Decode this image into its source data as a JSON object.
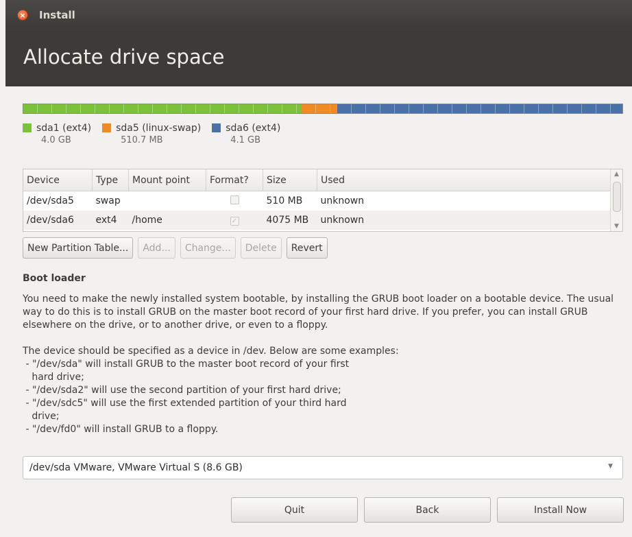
{
  "window": {
    "title": "Install"
  },
  "header": {
    "title": "Allocate drive space"
  },
  "partitions": [
    {
      "label": "sda1 (ext4)",
      "size": "4.0 GB",
      "color": "#7bc23a",
      "share": 0.465
    },
    {
      "label": "sda5 (linux-swap)",
      "size": "510.7 MB",
      "color": "#f08a25",
      "share": 0.059
    },
    {
      "label": "sda6 (ext4)",
      "size": "4.1 GB",
      "color": "#4a72a8",
      "share": 0.476
    }
  ],
  "table": {
    "columns": [
      "Device",
      "Type",
      "Mount point",
      "Format?",
      "Size",
      "Used"
    ],
    "rows": [
      {
        "device": "/dev/sda5",
        "type": "swap",
        "mount": "",
        "format": false,
        "size": "510 MB",
        "used": "unknown"
      },
      {
        "device": "/dev/sda6",
        "type": "ext4",
        "mount": "/home",
        "format": true,
        "size": "4075 MB",
        "used": "unknown"
      }
    ]
  },
  "buttons": {
    "new_table": "New Partition Table...",
    "add": "Add...",
    "change": "Change...",
    "delete": "Delete",
    "revert": "Revert"
  },
  "boot_loader": {
    "title": "Boot loader",
    "para1": "You need to make the newly installed system bootable, by installing the GRUB boot loader on a bootable device. The usual way to do this is to install GRUB on the master boot record of your first hard drive. If you prefer, you can install GRUB elsewhere on the drive, or to another drive, or even to a floppy.",
    "para2_lines": [
      "The device should be specified as a device in /dev. Below are some examples:",
      " - \"/dev/sda\" will install GRUB to the master boot record of your first",
      "   hard drive;",
      " - \"/dev/sda2\" will use the second partition of your first hard drive;",
      " - \"/dev/sdc5\" will use the first extended partition of your third hard",
      "   drive;",
      " - \"/dev/fd0\" will install GRUB to a floppy."
    ],
    "device": "/dev/sda VMware, VMware Virtual S (8.6 GB)"
  },
  "nav": {
    "quit": "Quit",
    "back": "Back",
    "install": "Install Now"
  }
}
